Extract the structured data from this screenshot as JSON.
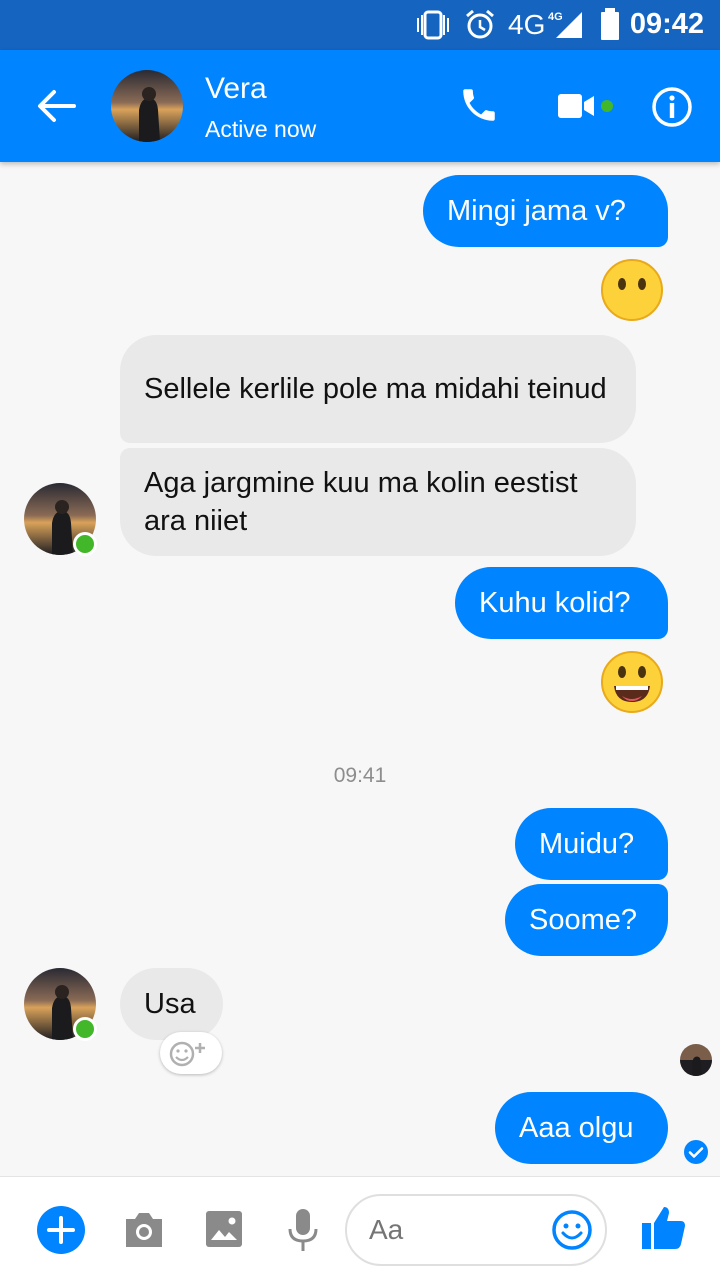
{
  "status_bar": {
    "network": "4G",
    "time": "09:42"
  },
  "header": {
    "contact_name": "Vera",
    "contact_status": "Active now",
    "icons": [
      "back-arrow-icon",
      "phone-icon",
      "video-camera-icon",
      "info-icon"
    ],
    "accent": "#0084ff"
  },
  "conversation": {
    "timestamp": "09:41",
    "messages": [
      {
        "from": "me",
        "text": "Mingi jama v?"
      },
      {
        "from": "me",
        "emoji": "neutral-face"
      },
      {
        "from": "Vera",
        "text": "Sellele kerlile pole ma midahi teinud"
      },
      {
        "from": "Vera",
        "text": "Aga jargmine kuu ma kolin eestist ara niiet"
      },
      {
        "from": "me",
        "text": "Kuhu kolid?"
      },
      {
        "from": "me",
        "emoji": "grinning-face"
      },
      {
        "from": "me",
        "text": "Muidu?"
      },
      {
        "from": "me",
        "text": "Soome?"
      },
      {
        "from": "Vera",
        "text": "Usa"
      },
      {
        "from": "me",
        "text": "Aaa olgu",
        "status": "delivered"
      }
    ]
  },
  "composer": {
    "placeholder": "Aa",
    "icons": [
      "plus-icon",
      "camera-icon",
      "gallery-icon",
      "microphone-icon",
      "emoji-icon",
      "thumbs-up-icon"
    ]
  }
}
